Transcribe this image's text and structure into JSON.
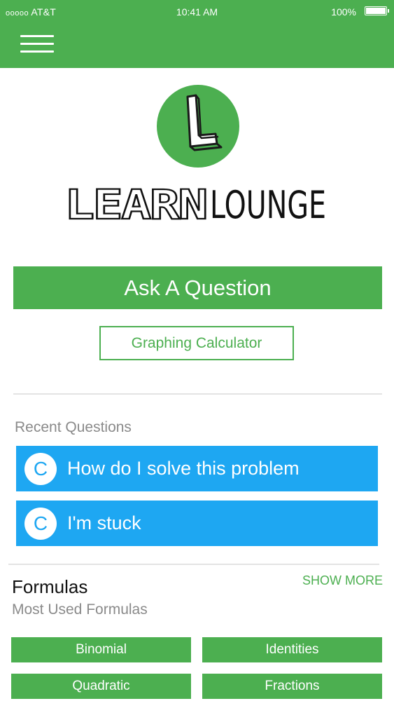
{
  "status_bar": {
    "carrier_dots": "ooooo",
    "carrier": "AT&T",
    "time": "10:41 AM",
    "battery_percent": "100%",
    "battery_level": 1.0
  },
  "header": {
    "menu_icon": "hamburger-menu-icon"
  },
  "logo": {
    "icon": "learnlounge-l-logo",
    "wordmark": "LEARNLOUNGE"
  },
  "actions": {
    "ask_question_label": "Ask A Question",
    "graphing_calculator_label": "Graphing Calculator"
  },
  "recent_questions": {
    "heading": "Recent Questions",
    "items": [
      {
        "avatar": "C",
        "text": "How do I solve this problem"
      },
      {
        "avatar": "C",
        "text": "I'm stuck"
      }
    ]
  },
  "formulas": {
    "title": "Formulas",
    "subtitle": "Most Used Formulas",
    "show_more_label": "SHOW MORE",
    "buttons": [
      "Binomial",
      "Identities",
      "Quadratic",
      "Fractions"
    ]
  },
  "colors": {
    "brand_green": "#4caf50",
    "question_blue": "#1ea7f2",
    "muted_text": "#8a8a8a"
  }
}
